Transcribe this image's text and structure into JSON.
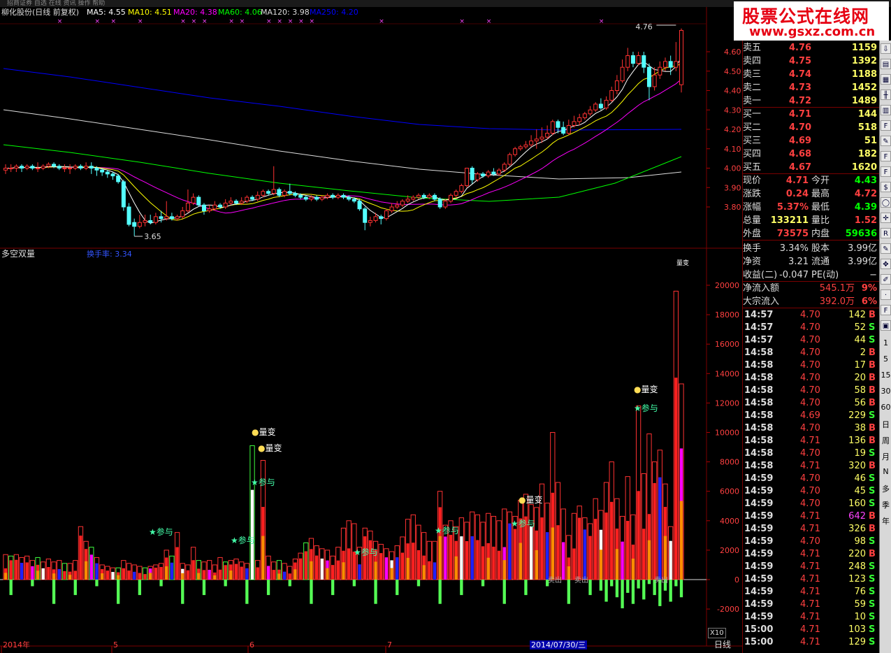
{
  "title_bar_text": "招商证券  自选  在线  资讯  操作  帮助",
  "kline": {
    "stock_label": "柳化股份(日线 前复权)",
    "mas": [
      {
        "label": "MA5: 4.55",
        "color": "#ffffff"
      },
      {
        "label": "MA10: 4.51",
        "color": "#ffff00"
      },
      {
        "label": "MA20: 4.38",
        "color": "#ff00ff"
      },
      {
        "label": "MA60: 4.06",
        "color": "#00ff00"
      },
      {
        "label": "MA120: 3.98",
        "color": "#dddddd"
      },
      {
        "label": "MA250: 4.20",
        "color": "#0000ff"
      }
    ],
    "y_ticks": [
      "4.60",
      "4.50",
      "4.40",
      "4.30",
      "4.20",
      "4.10",
      "4.00",
      "3.90",
      "3.80"
    ],
    "high_marker": "4.76",
    "low_marker": "3.65"
  },
  "volume": {
    "title": "多空双量",
    "turnover": "换手率: 3.34",
    "legend_tag": "量变",
    "y_ticks": [
      "20000",
      "18000",
      "16000",
      "14000",
      "12000",
      "10000",
      "8000",
      "6000",
      "4000",
      "2000",
      "0",
      "-2000"
    ],
    "scale_tag": "X10",
    "annotations": [
      {
        "text": "参与",
        "kind": "star"
      },
      {
        "text": "参与",
        "kind": "star"
      },
      {
        "text": "量变",
        "kind": "dot"
      },
      {
        "text": "量变",
        "kind": "dot"
      },
      {
        "text": "参与",
        "kind": "star"
      },
      {
        "text": "参与",
        "kind": "star"
      },
      {
        "text": "参与",
        "kind": "star"
      },
      {
        "text": "量变",
        "kind": "dot"
      },
      {
        "text": "参与",
        "kind": "star"
      },
      {
        "text": "量变",
        "kind": "dot"
      },
      {
        "text": "参与",
        "kind": "star"
      }
    ],
    "bottom_labels": [
      "卖出",
      "卖出",
      "卖出"
    ]
  },
  "axis": {
    "dates": [
      "2014年",
      "5",
      "6",
      "7"
    ],
    "cursor_date": "2014/07/30/三",
    "period": "日线"
  },
  "asks": [
    {
      "name": "卖五",
      "price": "4.76",
      "vol": "1159"
    },
    {
      "name": "卖四",
      "price": "4.75",
      "vol": "1392"
    },
    {
      "name": "卖三",
      "price": "4.74",
      "vol": "1188"
    },
    {
      "name": "卖二",
      "price": "4.73",
      "vol": "1452"
    },
    {
      "name": "卖一",
      "price": "4.72",
      "vol": "1489"
    }
  ],
  "bids": [
    {
      "name": "买一",
      "price": "4.71",
      "vol": "144"
    },
    {
      "name": "买二",
      "price": "4.70",
      "vol": "518"
    },
    {
      "name": "买三",
      "price": "4.69",
      "vol": "51"
    },
    {
      "name": "买四",
      "price": "4.68",
      "vol": "182"
    },
    {
      "name": "买五",
      "price": "4.67",
      "vol": "1620"
    }
  ],
  "quote": [
    {
      "l1": "现价",
      "v1": "4.71",
      "c1": "#ff4040",
      "l2": "今开",
      "v2": "4.43",
      "c2": "#00ff00"
    },
    {
      "l1": "涨跌",
      "v1": "0.24",
      "c1": "#ff4040",
      "l2": "最高",
      "v2": "4.72",
      "c2": "#ff4040"
    },
    {
      "l1": "涨幅",
      "v1": "5.37%",
      "c1": "#ff4040",
      "l2": "最低",
      "v2": "4.39",
      "c2": "#00ff00"
    },
    {
      "l1": "总量",
      "v1": "133211",
      "c1": "#ffff66",
      "l2": "量比",
      "v2": "1.52",
      "c2": "#ff4040"
    },
    {
      "l1": "外盘",
      "v1": "73575",
      "c1": "#ff4040",
      "l2": "内盘",
      "v2": "59636",
      "c2": "#00ff00"
    }
  ],
  "fin": [
    {
      "l1": "换手",
      "v1": "3.34%",
      "l2": "股本",
      "v2": "3.99亿"
    },
    {
      "l1": "净资",
      "v1": "3.21",
      "l2": "流通",
      "v2": "3.99亿"
    },
    {
      "l1": "收益(二)",
      "v1": "-0.047",
      "l2": "PE(动)",
      "v2": "−"
    }
  ],
  "flow": [
    {
      "label": "净流入额",
      "value": "545.1万",
      "pct": "9%"
    },
    {
      "label": "大宗流入",
      "value": "392.0万",
      "pct": "6%"
    }
  ],
  "ticks": [
    {
      "t": "14:57",
      "p": "4.70",
      "v": "142",
      "s": "B"
    },
    {
      "t": "14:57",
      "p": "4.70",
      "v": "52",
      "s": "S"
    },
    {
      "t": "14:57",
      "p": "4.70",
      "v": "44",
      "s": "S"
    },
    {
      "t": "14:58",
      "p": "4.70",
      "v": "2",
      "s": "B"
    },
    {
      "t": "14:58",
      "p": "4.70",
      "v": "17",
      "s": "B"
    },
    {
      "t": "14:58",
      "p": "4.70",
      "v": "20",
      "s": "B"
    },
    {
      "t": "14:58",
      "p": "4.70",
      "v": "58",
      "s": "B"
    },
    {
      "t": "14:58",
      "p": "4.70",
      "v": "56",
      "s": "B"
    },
    {
      "t": "14:58",
      "p": "4.69",
      "v": "229",
      "s": "S"
    },
    {
      "t": "14:58",
      "p": "4.70",
      "v": "38",
      "s": "B"
    },
    {
      "t": "14:58",
      "p": "4.71",
      "v": "136",
      "s": "B"
    },
    {
      "t": "14:58",
      "p": "4.70",
      "v": "19",
      "s": "S"
    },
    {
      "t": "14:58",
      "p": "4.71",
      "v": "320",
      "s": "B"
    },
    {
      "t": "14:59",
      "p": "4.70",
      "v": "46",
      "s": "S"
    },
    {
      "t": "14:59",
      "p": "4.70",
      "v": "45",
      "s": "S"
    },
    {
      "t": "14:59",
      "p": "4.70",
      "v": "160",
      "s": "S"
    },
    {
      "t": "14:59",
      "p": "4.71",
      "v": "642",
      "s": "B"
    },
    {
      "t": "14:59",
      "p": "4.71",
      "v": "326",
      "s": "B"
    },
    {
      "t": "14:59",
      "p": "4.70",
      "v": "98",
      "s": "S"
    },
    {
      "t": "14:59",
      "p": "4.71",
      "v": "220",
      "s": "B"
    },
    {
      "t": "14:59",
      "p": "4.71",
      "v": "248",
      "s": "S"
    },
    {
      "t": "14:59",
      "p": "4.71",
      "v": "123",
      "s": "S"
    },
    {
      "t": "14:59",
      "p": "4.71",
      "v": "76",
      "s": "S"
    },
    {
      "t": "14:59",
      "p": "4.71",
      "v": "59",
      "s": "S"
    },
    {
      "t": "14:59",
      "p": "4.71",
      "v": "10",
      "s": "S"
    },
    {
      "t": "15:00",
      "p": "4.71",
      "v": "103",
      "s": "S"
    },
    {
      "t": "15:00",
      "p": "4.71",
      "v": "129",
      "s": "S"
    }
  ],
  "toolbar": {
    "icons": [
      "arrow-down-icon",
      "chart-icon",
      "grid-icon",
      "candle-icon",
      "bars-icon",
      "f10-icon",
      "note-icon",
      "f2-icon",
      "f6-icon",
      "dollar-icon",
      "circle-icon",
      "cross-icon",
      "rsi-icon",
      "pen-icon",
      "move-icon",
      "edit-icon",
      "sep-icon",
      "f5-icon",
      "layout-icon"
    ],
    "periods": [
      "1",
      "5",
      "15",
      "30",
      "60",
      "日",
      "周",
      "月",
      "N",
      "多",
      "季",
      "年"
    ]
  },
  "logo": {
    "cn": "股票公式在线网",
    "url": "www.gsxz.com.cn"
  },
  "chart_data": {
    "type": "candlestick",
    "title": "柳化股份(日线 前复权)",
    "ylim": [
      3.62,
      4.8
    ],
    "candles": [
      [
        3.99,
        4.0,
        3.97,
        4.02
      ],
      [
        4.0,
        4.0,
        3.98,
        4.02
      ],
      [
        4.0,
        4.01,
        3.98,
        4.02
      ],
      [
        4.01,
        4.0,
        3.98,
        4.02
      ],
      [
        4.0,
        4.01,
        3.99,
        4.02
      ],
      [
        4.01,
        4.0,
        3.99,
        4.02
      ],
      [
        4.0,
        4.0,
        3.98,
        4.03
      ],
      [
        4.0,
        4.01,
        3.99,
        4.02
      ],
      [
        4.01,
        4.02,
        4.0,
        4.03
      ],
      [
        4.02,
        4.01,
        4.0,
        4.03
      ],
      [
        4.01,
        4.0,
        3.99,
        4.02
      ],
      [
        4.0,
        4.0,
        3.98,
        4.02
      ],
      [
        4.0,
        4.0,
        3.97,
        4.02
      ],
      [
        4.0,
        4.01,
        3.99,
        4.02
      ],
      [
        4.01,
        4.0,
        3.99,
        4.02
      ],
      [
        4.0,
        4.01,
        3.99,
        4.03
      ],
      [
        4.01,
        4.0,
        3.97,
        4.03
      ],
      [
        4.0,
        3.99,
        3.96,
        4.01
      ],
      [
        3.99,
        3.98,
        3.96,
        4.0
      ],
      [
        3.98,
        3.97,
        3.95,
        3.99
      ],
      [
        3.97,
        3.96,
        3.94,
        3.98
      ],
      [
        3.96,
        3.93,
        3.92,
        3.97
      ],
      [
        3.93,
        3.8,
        3.78,
        3.94
      ],
      [
        3.8,
        3.71,
        3.7,
        3.82
      ],
      [
        3.72,
        3.7,
        3.65,
        3.74
      ],
      [
        3.7,
        3.72,
        3.69,
        3.76
      ],
      [
        3.72,
        3.73,
        3.7,
        3.76
      ],
      [
        3.73,
        3.72,
        3.71,
        3.76
      ],
      [
        3.72,
        3.75,
        3.71,
        3.77
      ],
      [
        3.75,
        3.74,
        3.72,
        3.78
      ],
      [
        3.74,
        3.75,
        3.73,
        3.83
      ],
      [
        3.75,
        3.74,
        3.73,
        3.77
      ],
      [
        3.74,
        3.75,
        3.73,
        3.76
      ],
      [
        3.75,
        3.78,
        3.74,
        3.8
      ],
      [
        3.78,
        3.82,
        3.77,
        3.89
      ],
      [
        3.82,
        3.85,
        3.81,
        3.87
      ],
      [
        3.85,
        3.81,
        3.8,
        3.86
      ],
      [
        3.81,
        3.78,
        3.76,
        3.82
      ],
      [
        3.78,
        3.79,
        3.77,
        3.81
      ],
      [
        3.79,
        3.81,
        3.78,
        3.83
      ],
      [
        3.81,
        3.8,
        3.79,
        3.82
      ],
      [
        3.8,
        3.82,
        3.79,
        3.84
      ],
      [
        3.82,
        3.83,
        3.81,
        3.85
      ],
      [
        3.83,
        3.82,
        3.81,
        3.84
      ],
      [
        3.82,
        3.83,
        3.81,
        3.85
      ],
      [
        3.83,
        3.85,
        3.82,
        3.86
      ],
      [
        3.85,
        3.84,
        3.83,
        3.86
      ],
      [
        3.84,
        3.86,
        3.83,
        3.88
      ],
      [
        3.86,
        3.88,
        3.85,
        3.89
      ],
      [
        3.88,
        3.87,
        3.86,
        3.89
      ],
      [
        3.87,
        3.89,
        3.86,
        4.01
      ],
      [
        3.89,
        3.86,
        3.85,
        3.9
      ],
      [
        3.86,
        3.88,
        3.85,
        3.89
      ],
      [
        3.88,
        3.87,
        3.86,
        3.92
      ],
      [
        3.87,
        3.86,
        3.85,
        3.88
      ],
      [
        3.86,
        3.85,
        3.84,
        3.87
      ],
      [
        3.85,
        3.84,
        3.83,
        3.86
      ],
      [
        3.84,
        3.85,
        3.83,
        3.86
      ],
      [
        3.85,
        3.84,
        3.83,
        3.86
      ],
      [
        3.84,
        3.85,
        3.83,
        3.86
      ],
      [
        3.85,
        3.86,
        3.84,
        3.87
      ],
      [
        3.86,
        3.85,
        3.84,
        3.87
      ],
      [
        3.85,
        3.86,
        3.84,
        3.87
      ],
      [
        3.86,
        3.85,
        3.84,
        3.87
      ],
      [
        3.85,
        3.84,
        3.83,
        3.86
      ],
      [
        3.84,
        3.83,
        3.82,
        3.85
      ],
      [
        3.83,
        3.79,
        3.78,
        3.84
      ],
      [
        3.79,
        3.72,
        3.68,
        3.8
      ],
      [
        3.72,
        3.73,
        3.7,
        3.75
      ],
      [
        3.73,
        3.75,
        3.72,
        3.77
      ],
      [
        3.75,
        3.74,
        3.71,
        3.76
      ],
      [
        3.74,
        3.78,
        3.73,
        3.79
      ],
      [
        3.78,
        3.8,
        3.77,
        3.82
      ],
      [
        3.8,
        3.81,
        3.79,
        3.83
      ],
      [
        3.81,
        3.83,
        3.8,
        3.84
      ],
      [
        3.83,
        3.84,
        3.82,
        3.86
      ],
      [
        3.84,
        3.85,
        3.83,
        3.86
      ],
      [
        3.85,
        3.86,
        3.84,
        3.87
      ],
      [
        3.86,
        3.85,
        3.84,
        3.87
      ],
      [
        3.85,
        3.86,
        3.84,
        3.87
      ],
      [
        3.86,
        3.84,
        3.83,
        3.87
      ],
      [
        3.84,
        3.8,
        3.79,
        3.85
      ],
      [
        3.8,
        3.83,
        3.79,
        3.84
      ],
      [
        3.83,
        3.86,
        3.82,
        3.87
      ],
      [
        3.86,
        3.88,
        3.85,
        3.89
      ],
      [
        3.88,
        3.91,
        3.87,
        3.92
      ],
      [
        3.91,
        4.0,
        3.9,
        4.0
      ],
      [
        4.0,
        3.94,
        3.92,
        4.01
      ],
      [
        3.94,
        3.97,
        3.93,
        3.98
      ],
      [
        3.97,
        3.96,
        3.95,
        3.98
      ],
      [
        3.96,
        3.98,
        3.95,
        3.99
      ],
      [
        3.98,
        3.97,
        3.96,
        4.0
      ],
      [
        3.97,
        3.99,
        3.96,
        4.0
      ],
      [
        3.99,
        4.02,
        3.98,
        4.03
      ],
      [
        4.02,
        4.07,
        4.01,
        4.08
      ],
      [
        4.07,
        4.1,
        4.06,
        4.11
      ],
      [
        4.1,
        4.11,
        4.09,
        4.12
      ],
      [
        4.11,
        4.12,
        4.1,
        4.14
      ],
      [
        4.12,
        4.14,
        4.11,
        4.17
      ],
      [
        4.14,
        4.15,
        4.1,
        4.2
      ],
      [
        4.15,
        4.16,
        4.13,
        4.21
      ],
      [
        4.16,
        4.18,
        4.15,
        4.22
      ],
      [
        4.18,
        4.24,
        4.17,
        4.25
      ],
      [
        4.24,
        4.21,
        4.18,
        4.25
      ],
      [
        4.21,
        4.18,
        4.17,
        4.24
      ],
      [
        4.18,
        4.22,
        4.17,
        4.25
      ],
      [
        4.22,
        4.24,
        4.21,
        4.27
      ],
      [
        4.24,
        4.26,
        4.22,
        4.28
      ],
      [
        4.26,
        4.28,
        4.25,
        4.29
      ],
      [
        4.28,
        4.3,
        4.27,
        4.32
      ],
      [
        4.3,
        4.33,
        4.29,
        4.34
      ],
      [
        4.33,
        4.31,
        4.3,
        4.36
      ],
      [
        4.31,
        4.35,
        4.3,
        4.37
      ],
      [
        4.35,
        4.4,
        4.34,
        4.42
      ],
      [
        4.4,
        4.45,
        4.38,
        4.48
      ],
      [
        4.45,
        4.52,
        4.44,
        4.56
      ],
      [
        4.52,
        4.58,
        4.5,
        4.62
      ],
      [
        4.58,
        4.54,
        4.52,
        4.6
      ],
      [
        4.54,
        4.58,
        4.53,
        4.6
      ],
      [
        4.58,
        4.52,
        4.49,
        4.6
      ],
      [
        4.52,
        4.42,
        4.35,
        4.54
      ],
      [
        4.42,
        4.48,
        4.4,
        4.52
      ],
      [
        4.48,
        4.52,
        4.46,
        4.55
      ],
      [
        4.52,
        4.55,
        4.5,
        4.57
      ],
      [
        4.55,
        4.52,
        4.48,
        4.58
      ],
      [
        4.52,
        4.55,
        4.5,
        4.65
      ],
      [
        4.43,
        4.71,
        4.39,
        4.72
      ]
    ]
  }
}
